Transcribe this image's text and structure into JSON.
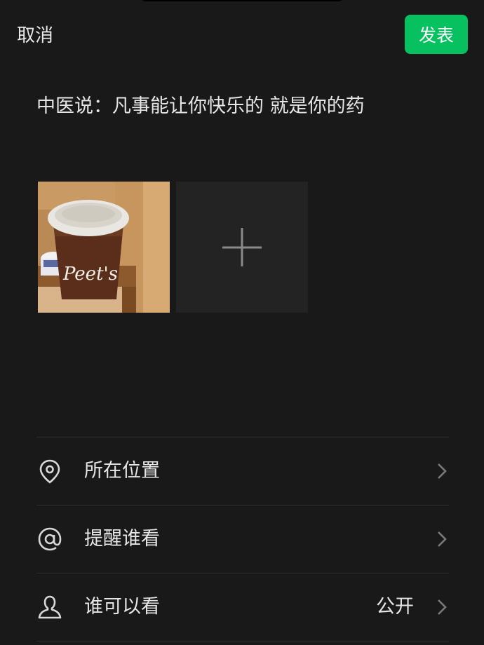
{
  "header": {
    "cancel_label": "取消",
    "publish_label": "发表",
    "publish_color": "#07c160"
  },
  "post": {
    "text": "中医说：凡事能让你快乐的 就是你的药"
  },
  "photos": [
    {
      "description_icon": "coffee-cup-photo",
      "cup_text": "Peet's"
    }
  ],
  "add_photo": {
    "icon": "plus-icon"
  },
  "options": [
    {
      "icon": "location-pin-icon",
      "label": "所在位置",
      "value": ""
    },
    {
      "icon": "at-sign-icon",
      "label": "提醒谁看",
      "value": ""
    },
    {
      "icon": "person-icon",
      "label": "谁可以看",
      "value": "公开"
    }
  ],
  "colors": {
    "background": "#191919",
    "divider": "#2e2e2e",
    "tile": "#232323"
  }
}
